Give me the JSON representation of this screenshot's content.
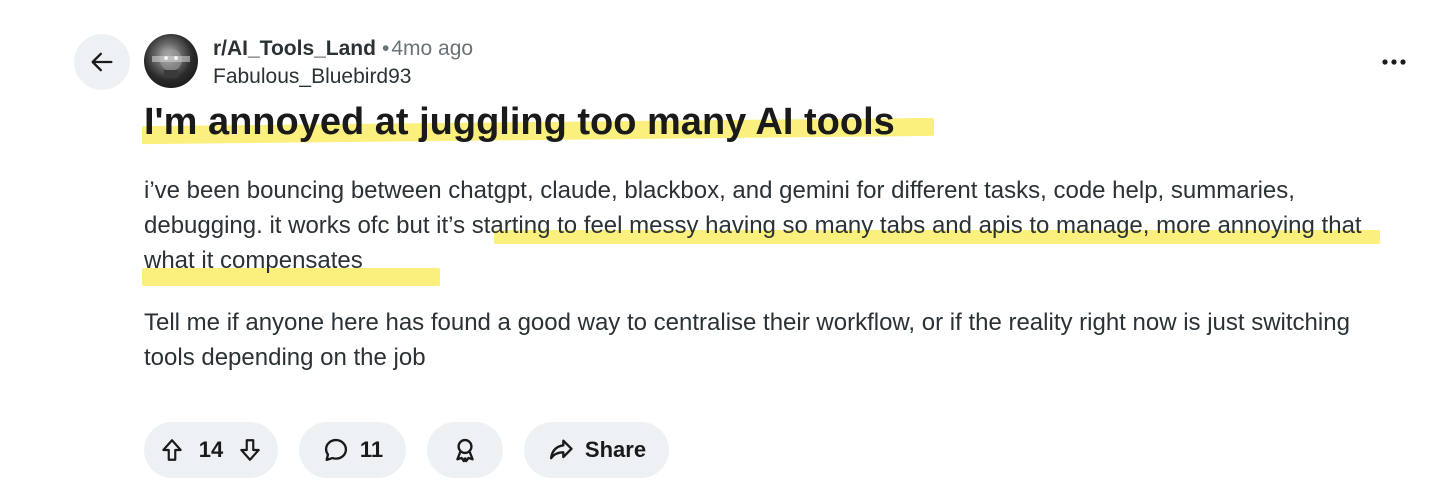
{
  "post": {
    "subreddit": "r/AI_Tools_Land",
    "separator": "•",
    "age": "4mo ago",
    "author": "Fabulous_Bluebird93",
    "title": "I'm annoyed at juggling too many AI tools",
    "paragraphs": [
      "i’ve been bouncing between chatgpt, claude, blackbox, and gemini for different tasks, code help, summaries, debugging. it works ofc but it’s starting to feel messy having so many tabs and apis to manage, more annoying that what it compensates",
      "Tell me if anyone here has found a good way to centralise their workflow, or if the reality right now is just switching tools depending on the job"
    ]
  },
  "actions": {
    "score": "14",
    "comments": "11",
    "share_label": "Share"
  },
  "icons": {
    "back": "arrow-left-icon",
    "more": "more-horizontal-icon",
    "upvote": "arrow-up-icon",
    "downvote": "arrow-down-icon",
    "comment": "chat-bubble-icon",
    "award": "award-ribbon-icon",
    "share": "share-arrow-icon"
  },
  "colors": {
    "highlight": "#fbee6f",
    "chip_bg": "#eef1f3",
    "text": "#2a3236"
  }
}
